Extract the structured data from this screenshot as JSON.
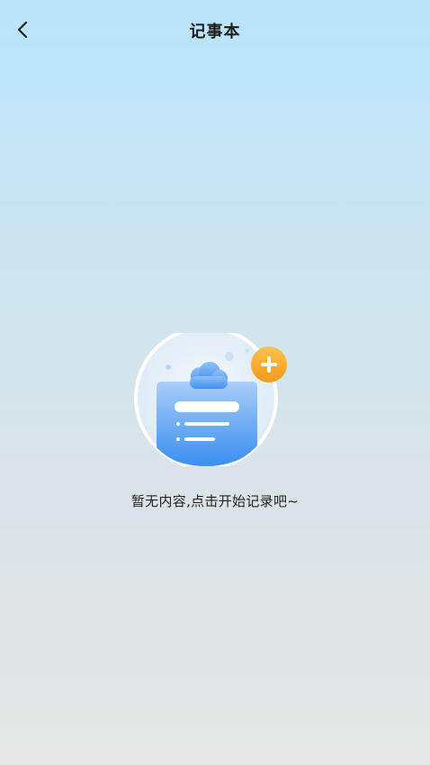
{
  "header": {
    "back_icon": "chevron-left-icon",
    "title": "记事本"
  },
  "empty_state": {
    "illustration_icon": "notepad-cloud-icon",
    "add_icon": "plus-icon",
    "message": "暂无内容,点击开始记录吧~"
  },
  "colors": {
    "background_top": "#b9e4fb",
    "background_bottom": "#e6e6e6",
    "note_blue": "#4a98f2",
    "add_badge": "#f6a622",
    "title_text": "#1d1d1d"
  }
}
